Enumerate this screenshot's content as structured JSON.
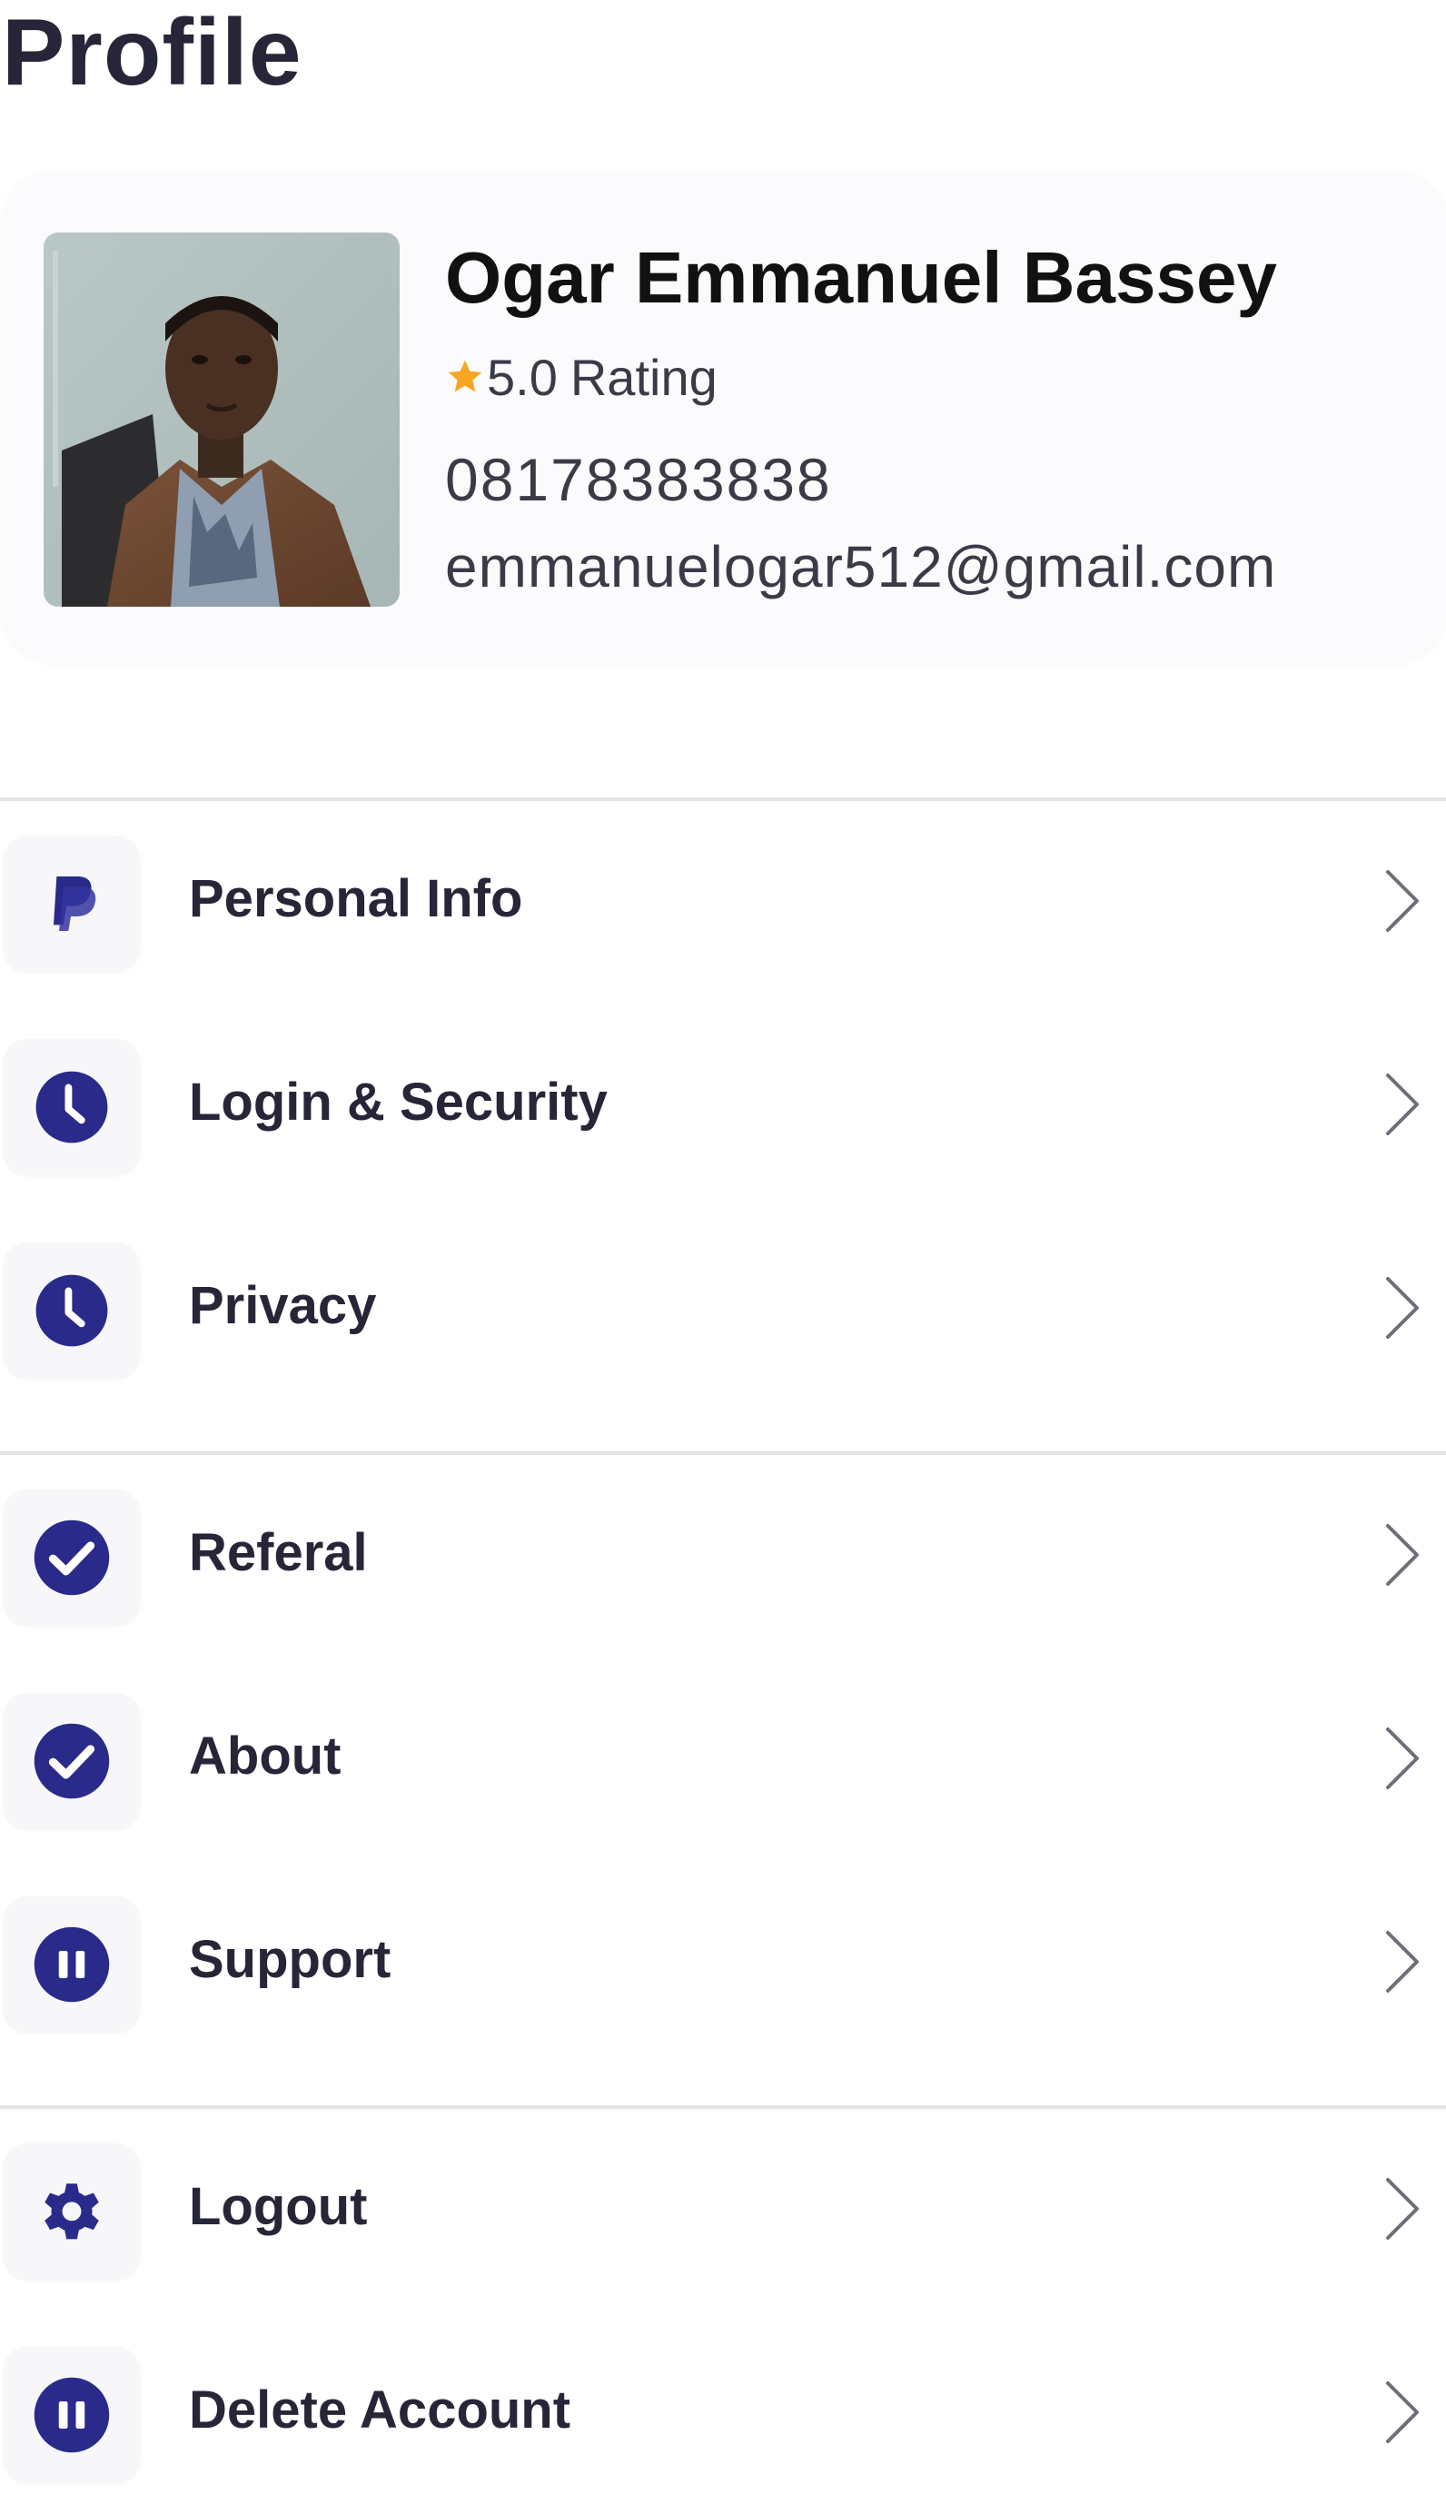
{
  "header": {
    "title": "Profile"
  },
  "profile": {
    "name": "Ogar Emmanuel Bassey",
    "rating_value": "5.0",
    "rating_label": "Rating",
    "phone": "08178383838",
    "email": "emmanuelogar512@gmail.com",
    "avatar_icon": "profile-photo"
  },
  "menu": {
    "items": [
      {
        "label": "Personal Info",
        "icon": "paypal-icon"
      },
      {
        "label": "Login & Security",
        "icon": "clock-icon"
      },
      {
        "label": "Privacy",
        "icon": "clock-icon"
      },
      {
        "label": "Referal",
        "icon": "check-circle-icon"
      },
      {
        "label": "About",
        "icon": "check-circle-icon"
      },
      {
        "label": "Support",
        "icon": "pause-circle-icon"
      },
      {
        "label": "Logout",
        "icon": "gear-icon"
      },
      {
        "label": "Delete Account",
        "icon": "pause-circle-icon"
      }
    ]
  },
  "colors": {
    "accent": "#2a2a8a",
    "star": "#f5a623",
    "text_dark": "#262638",
    "text_muted": "#3b3b48",
    "divider": "#e4e4e8",
    "tile_bg": "#f7f7fa",
    "card_bg": "#fbfbfe"
  }
}
